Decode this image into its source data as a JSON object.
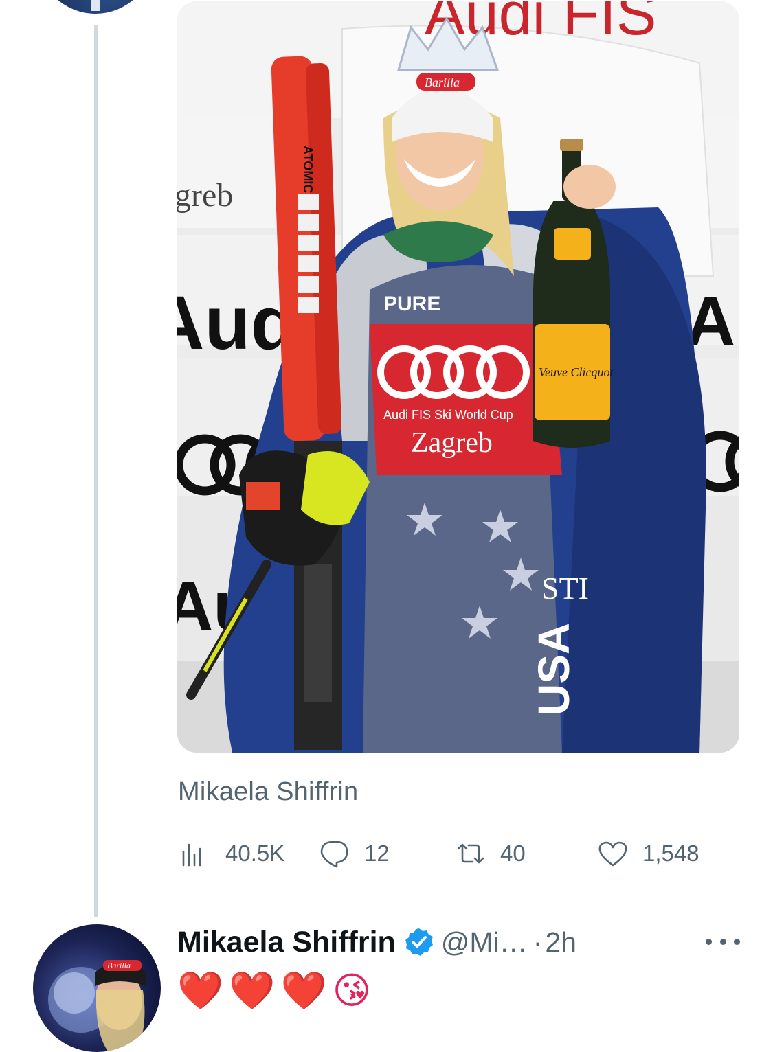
{
  "thread": {
    "parent_tweet": {
      "media": {
        "image": "skier-podium-photo",
        "banner_text_fragments": [
          "Audi FIS",
          "greb",
          "Audi",
          "Au",
          "Au"
        ],
        "bib_text": [
          "PURE",
          "Audi FIS Ski World Cup",
          "Zagreb"
        ],
        "ski_brand": "ATOMIC",
        "headwear_brand": "Barilla",
        "bottle_label": "Veuve Clicquot"
      },
      "caption": "Mikaela Shiffrin",
      "stats": {
        "views": "40.5K",
        "replies": "12",
        "retweets": "40",
        "likes": "1,548"
      }
    },
    "reply_tweet": {
      "display_name": "Mikaela Shiffrin",
      "handle": "@Mi…",
      "separator": "·",
      "time": "2h",
      "text": "❤️❤️❤️😘",
      "avatar_text": "Barilla"
    }
  },
  "icons": {
    "views": "bar-chart-icon",
    "reply": "speech-bubble-icon",
    "retweet": "retweet-arrows-icon",
    "like": "heart-icon",
    "verified": "verified-badge-icon",
    "more": "ellipsis-icon"
  },
  "colors": {
    "secondary_text": "#536471",
    "primary_text": "#0f1419",
    "verified_blue": "#1d9bf0",
    "thread_line": "#cfd9de"
  }
}
